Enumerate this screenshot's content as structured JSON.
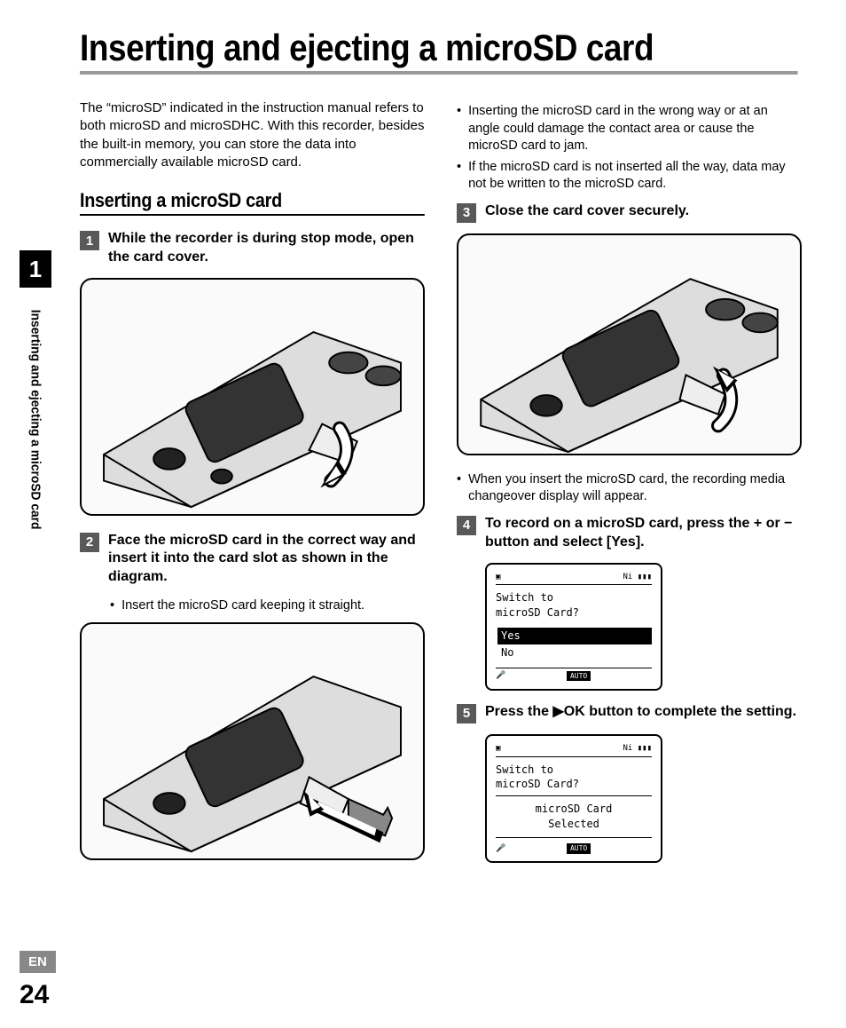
{
  "page_title": "Inserting and ejecting a microSD card",
  "intro": "The “microSD” indicated in the instruction manual refers to both microSD and microSDHC. With this recorder, besides the built-in memory, you can store the data into commercially available microSD card.",
  "section_heading": "Inserting a microSD card",
  "steps": {
    "s1": {
      "num": "1",
      "text": "While the recorder is during stop mode, open the card cover."
    },
    "s2": {
      "num": "2",
      "text": "Face the microSD card in the correct way and insert it into the card slot as shown in the diagram."
    },
    "s2_notes": {
      "n1": "Insert the microSD card keeping it straight."
    },
    "s2_notes_right": {
      "n1": "Inserting the microSD card in the wrong way or at an angle could damage the contact area or cause the microSD card to jam.",
      "n2": "If the microSD card is not inserted all the way, data may not be written to the microSD card."
    },
    "s3": {
      "num": "3",
      "text": "Close the card cover securely."
    },
    "s3_notes": {
      "n1": "When you insert the microSD card, the recording media changeover display will appear."
    },
    "s4": {
      "num": "4",
      "text_a": "To record on a microSD card, press the + or − button and select [",
      "text_b": "Yes",
      "text_c": "]."
    },
    "s5": {
      "num": "5",
      "text_a": "Press the ",
      "text_b": "▶OK",
      "text_c": " button to complete the setting."
    }
  },
  "screen1": {
    "prompt1": "Switch to",
    "prompt2": "microSD Card?",
    "opt_yes": "Yes",
    "opt_no": "No",
    "auto": "AUTO"
  },
  "screen2": {
    "prompt1": "Switch to",
    "prompt2": "microSD Card?",
    "line1": "microSD Card",
    "line2": "Selected",
    "auto": "AUTO"
  },
  "sidebar": {
    "chapter": "1",
    "label": "Inserting and ejecting a microSD card"
  },
  "footer": {
    "lang": "EN",
    "page": "24"
  }
}
